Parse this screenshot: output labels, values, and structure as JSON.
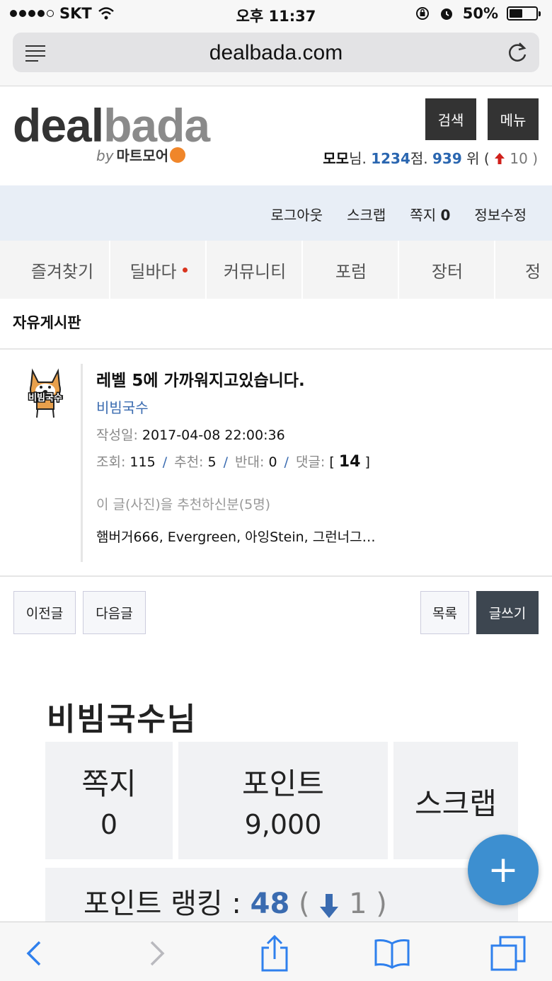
{
  "status_bar": {
    "carrier": "SKT",
    "time": "오후 11:37",
    "battery": "50%"
  },
  "browser": {
    "url": "dealbada.com"
  },
  "header": {
    "logo_deal": "deal",
    "logo_bada": "bada",
    "logo_by": "by",
    "logo_sub": "마트모어",
    "search_label": "검색",
    "menu_label": "메뉴",
    "user": {
      "name": "모모",
      "honorific": "님.",
      "points": "1234",
      "points_unit": "점.",
      "rank": "939",
      "rank_unit": "위 (",
      "rank_change": "10 )"
    }
  },
  "member_bar": {
    "logout": "로그아웃",
    "scrap": "스크랩",
    "memo": "쪽지",
    "memo_count": "0",
    "edit_info": "정보수정"
  },
  "categories": [
    {
      "label": "즐겨찾기"
    },
    {
      "label": "딜바다"
    },
    {
      "label": "커뮤니티"
    },
    {
      "label": "포럼"
    },
    {
      "label": "장터"
    },
    {
      "label": "정"
    }
  ],
  "board": {
    "title": "자유게시판"
  },
  "post": {
    "avatar_text": "비빔국수",
    "title": "레벨 5에 가까워지고있습니다.",
    "author": "비빔국수",
    "date_label": "작성일:",
    "date": "2017-04-08 22:00:36",
    "views_label": "조회:",
    "views": "115",
    "recommend_label": "추천:",
    "recommend": "5",
    "oppose_label": "반대:",
    "oppose": "0",
    "comments_label": "댓글:",
    "comments_open": "[",
    "comments": "14",
    "comments_close": "]",
    "recommenders_label": "이 글(사진)을 추천하신분(5명)",
    "recommenders": "햄버거666, Evergreen, 아잉Stein, 그런너그…"
  },
  "nav_buttons": {
    "prev": "이전글",
    "next": "다음글",
    "list": "목록",
    "write": "글쓰기"
  },
  "embedded_image": {
    "title": "비빔국수님",
    "memo_label": "쪽지",
    "memo_value": "0",
    "points_label": "포인트",
    "points_value": "9,000",
    "scrap_label": "스크랩",
    "rank_label": "포인트 랭킹 :",
    "rank_value": "48",
    "rank_open": "(",
    "rank_change": "1",
    "rank_close": ")"
  },
  "fab": {
    "label": "+"
  }
}
